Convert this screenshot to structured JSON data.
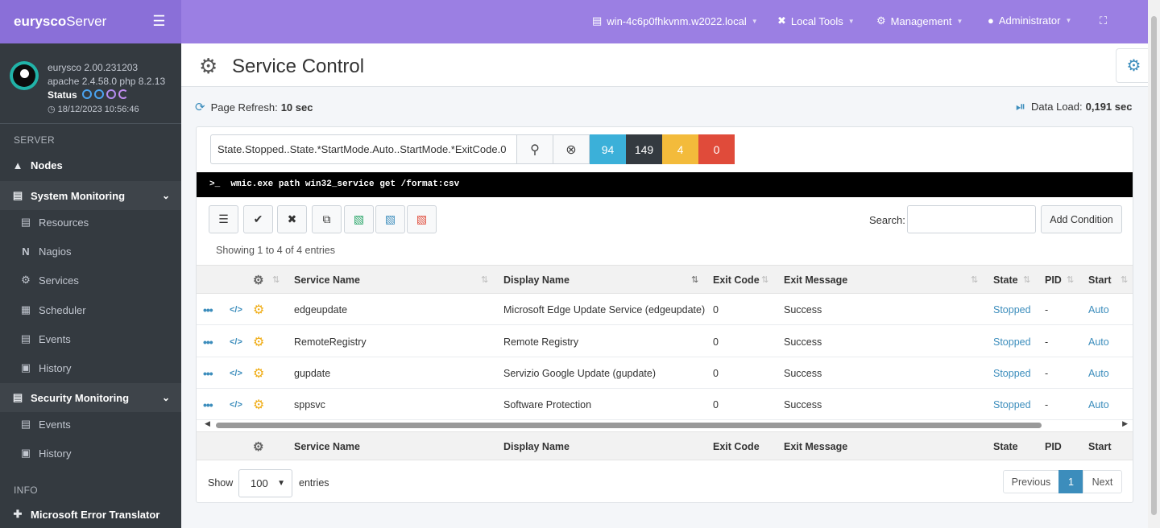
{
  "brand": {
    "prefix": "eurysco",
    "suffix": "Server"
  },
  "server_info": {
    "version": "eurysco 2.00.231203",
    "stack": "apache 2.4.58.0  php 8.2.13",
    "status_label": "Status",
    "datetime": "18/12/2023 10:56:46"
  },
  "sidebar": {
    "section_server": "SERVER",
    "nodes": "Nodes",
    "system_monitoring": "System Monitoring",
    "sys_items": [
      "Resources",
      "Nagios",
      "Services",
      "Scheduler",
      "Events",
      "History"
    ],
    "security_monitoring": "Security Monitoring",
    "sec_items": [
      "Events",
      "History"
    ],
    "section_info": "INFO",
    "error_translator": "Microsoft Error Translator"
  },
  "topbar": {
    "host": "win-4c6p0fhkvnm.w2022.local",
    "local_tools": "Local Tools",
    "management": "Management",
    "user": "Administrator"
  },
  "page": {
    "title": "Service Control",
    "refresh_label": "Page Refresh:",
    "refresh_value": "10 sec",
    "load_label": "Data Load:",
    "load_value": "0,191 sec"
  },
  "filter": {
    "query": "State.Stopped..State.*StartMode.Auto..StartMode.*ExitCode.0",
    "counts": [
      {
        "value": "94",
        "color": "#3bb0d9"
      },
      {
        "value": "149",
        "color": "#343a40"
      },
      {
        "value": "4",
        "color": "#f3bb3b"
      },
      {
        "value": "0",
        "color": "#e04b3a"
      }
    ]
  },
  "command": "wmic.exe path win32_service get /format:csv",
  "toolbar": {
    "icons": [
      "list-check-icon",
      "save-check-icon",
      "save-remove-icon",
      "copy-icon",
      "excel-icon",
      "csv-icon",
      "pdf-icon"
    ],
    "search_label": "Search:",
    "add_condition": "Add Condition"
  },
  "table": {
    "showing": "Showing 1 to 4 of 4 entries",
    "headers": {
      "service_name": "Service Name",
      "display_name": "Display Name",
      "exit_code": "Exit Code",
      "exit_message": "Exit Message",
      "state": "State",
      "pid": "PID",
      "start": "Start"
    },
    "rows": [
      {
        "service": "edgeupdate",
        "display": "Microsoft Edge Update Service (edgeupdate)",
        "exit_code": "0",
        "exit_message": "Success",
        "state": "Stopped",
        "pid": "-",
        "start": "Auto"
      },
      {
        "service": "RemoteRegistry",
        "display": "Remote Registry",
        "exit_code": "0",
        "exit_message": "Success",
        "state": "Stopped",
        "pid": "-",
        "start": "Auto"
      },
      {
        "service": "gupdate",
        "display": "Servizio Google Update (gupdate)",
        "exit_code": "0",
        "exit_message": "Success",
        "state": "Stopped",
        "pid": "-",
        "start": "Auto"
      },
      {
        "service": "sppsvc",
        "display": "Software Protection",
        "exit_code": "0",
        "exit_message": "Success",
        "state": "Stopped",
        "pid": "-",
        "start": "Auto"
      }
    ]
  },
  "footer": {
    "show": "Show",
    "page_size": "100",
    "entries": "entries",
    "previous": "Previous",
    "current_page": "1",
    "next": "Next"
  }
}
